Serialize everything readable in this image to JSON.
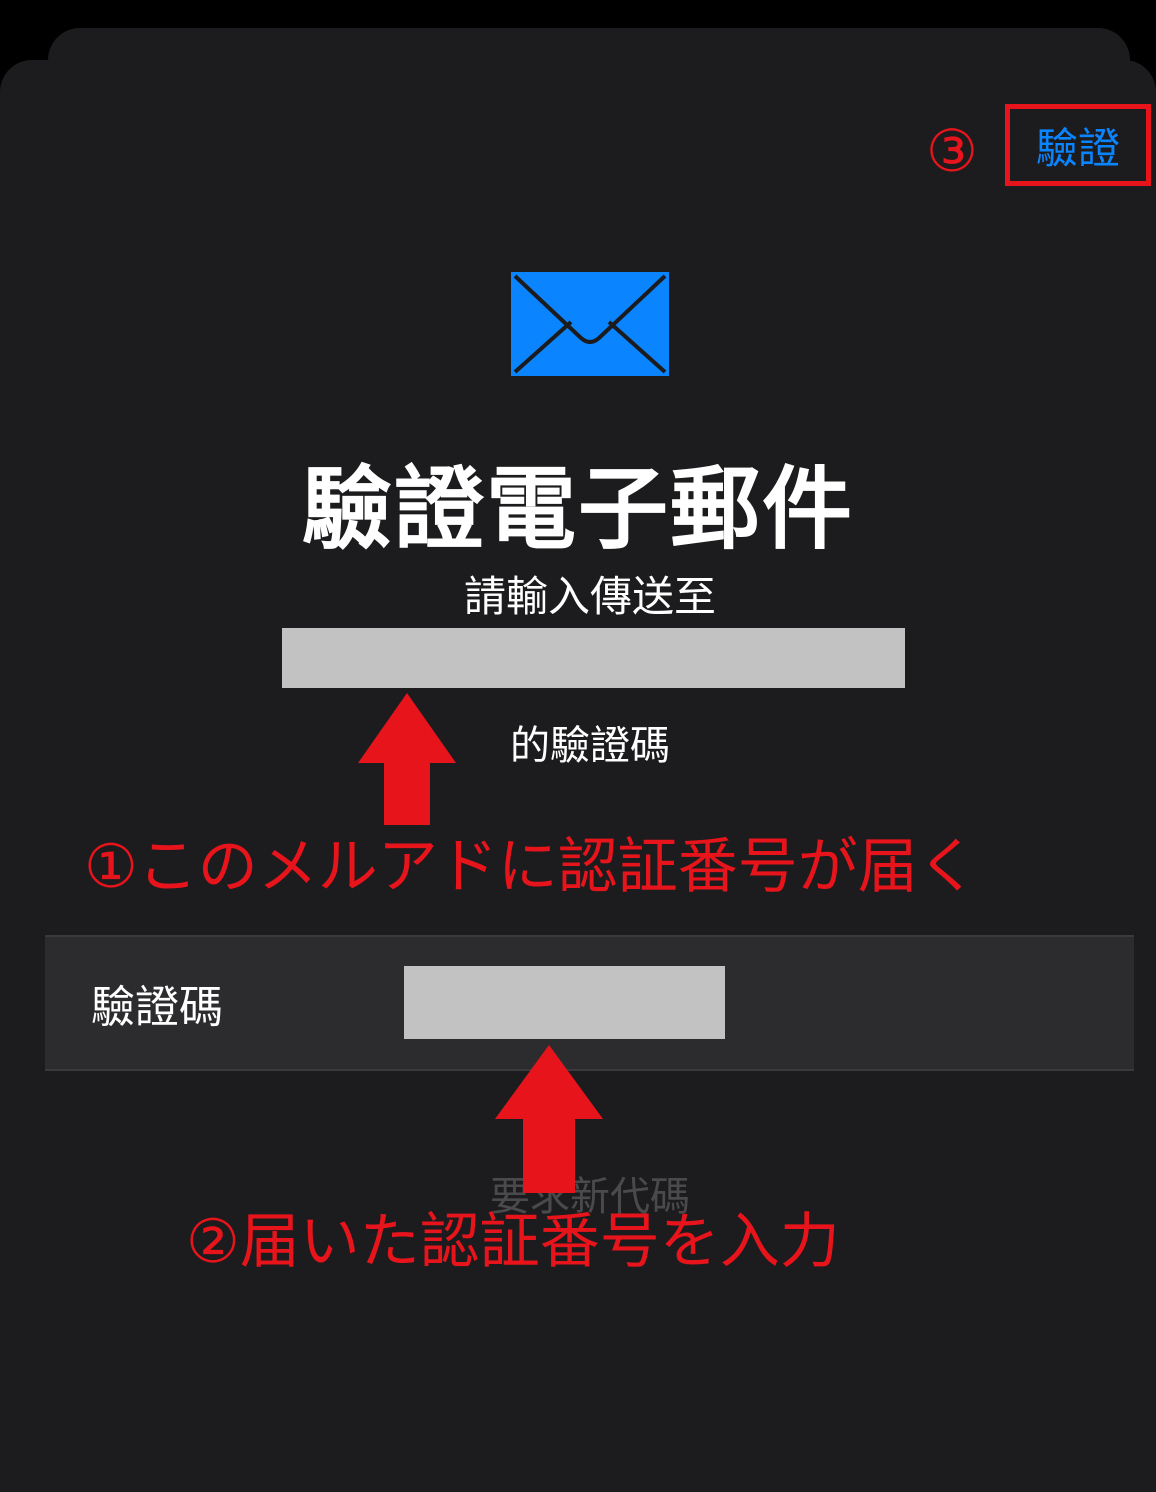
{
  "header": {
    "step3_marker": "③",
    "verify_button_label": "驗證"
  },
  "content": {
    "icon": "envelope-icon",
    "title": "驗證電子郵件",
    "instruction_before": "請輸入傳送至",
    "instruction_after": "的驗證碼"
  },
  "code_field": {
    "label": "驗證碼",
    "value": ""
  },
  "resend_label": "要求新代碼",
  "annotations": {
    "note1": "①このメルアドに認証番号が届く",
    "note2": "②届いた認証番号を入力"
  },
  "colors": {
    "accent": "#0a84ff",
    "annotation_red": "#e8141c",
    "background": "#1c1c1e",
    "mask_gray": "#c2c2c2"
  }
}
